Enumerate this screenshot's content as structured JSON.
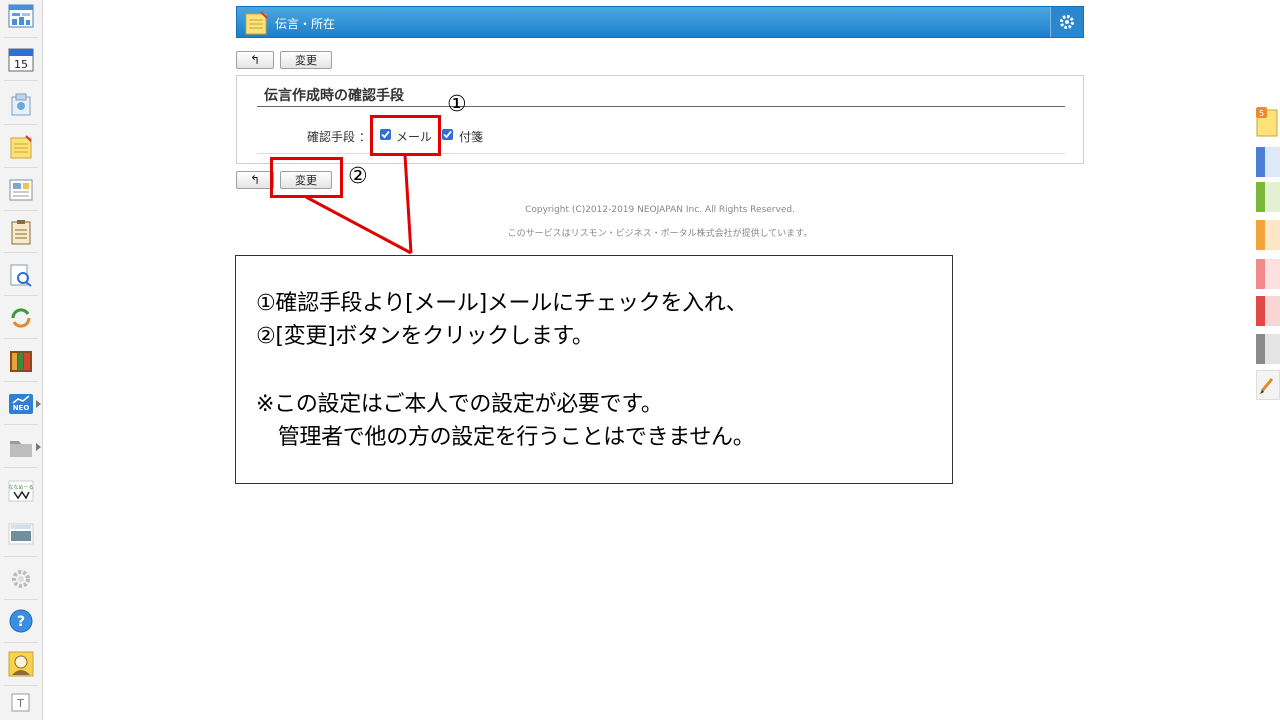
{
  "header": {
    "title": "伝言・所在"
  },
  "toolbar": {
    "back_symbol": "↰",
    "change_label": "変更"
  },
  "section": {
    "title": "伝言作成時の確認手段",
    "method_label": "確認手段 ：",
    "options": [
      {
        "label": "メール",
        "checked": true
      },
      {
        "label": "付箋",
        "checked": true
      }
    ]
  },
  "footer": {
    "copyright": "Copyright (C)2012-2019 NEOJAPAN Inc. All Rights Reserved.",
    "service_note": "このサービスはリスモン・ビジネス・ポータル株式会社が提供しています。"
  },
  "annotations": {
    "marker1": "①",
    "marker2": "②"
  },
  "callout": {
    "line1": "①確認手段より[メール]メールにチェックを入れ、",
    "line2": "②[変更]ボタンをクリックします。",
    "line3": "※この設定はご本人での設定が必要です。",
    "line4": "　管理者で他の方の設定を行うことはできません。"
  },
  "colors": {
    "header_blue": "#1d7fcb",
    "annotation_red": "#e00000",
    "checkbox_blue": "#2f6fd3"
  },
  "icons": {
    "left_sidebar": [
      "portal-icon",
      "calendar-icon",
      "facility-icon",
      "memo-icon",
      "bulletin-icon",
      "clipboard-icon",
      "search-icon",
      "sync-icon",
      "cabinet-icon",
      "neo-icon",
      "folder-icon",
      "app-icon",
      "photo-icon",
      "settings-icon",
      "help-icon",
      "user-icon",
      "text-icon"
    ],
    "calendar_day": "15",
    "neo_label": "NEO",
    "right_sidebar_badge": "5"
  }
}
